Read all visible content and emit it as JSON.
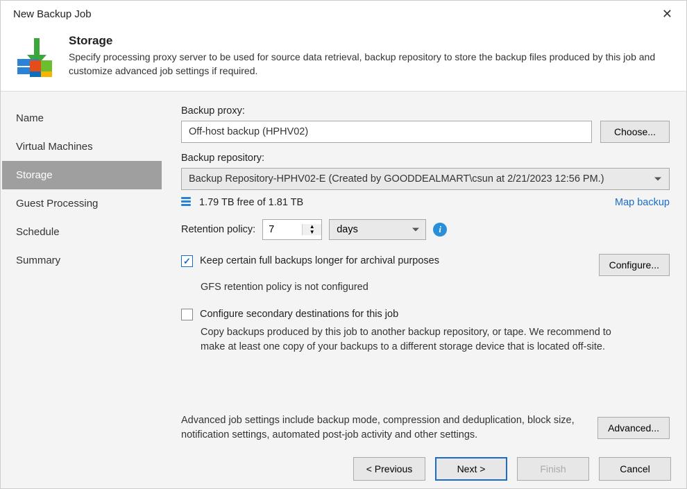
{
  "window": {
    "title": "New Backup Job"
  },
  "header": {
    "title": "Storage",
    "description": "Specify processing proxy server to be used for source data retrieval, backup repository to store the backup files produced by this job and customize advanced job settings if required."
  },
  "sidebar": {
    "items": [
      {
        "label": "Name"
      },
      {
        "label": "Virtual Machines"
      },
      {
        "label": "Storage",
        "selected": true
      },
      {
        "label": "Guest Processing"
      },
      {
        "label": "Schedule"
      },
      {
        "label": "Summary"
      }
    ]
  },
  "content": {
    "backupProxyLabel": "Backup proxy:",
    "backupProxyValue": "Off-host backup (HPHV02)",
    "chooseLabel": "Choose...",
    "backupRepoLabel": "Backup repository:",
    "backupRepoSelected": "Backup Repository-HPHV02-E (Created by GOODDEALMART\\csun at 2/21/2023 12:56 PM.)",
    "freeSpace": "1.79 TB free of 1.81 TB",
    "mapBackup": "Map backup",
    "retentionLabel": "Retention policy:",
    "retentionValue": "7",
    "retentionUnit": "days",
    "configureLabel": "Configure...",
    "keepFullLabel": "Keep certain full backups longer for archival purposes",
    "keepFullSub": "GFS retention policy is not configured",
    "secondaryLabel": "Configure secondary destinations for this job",
    "secondarySub": "Copy backups produced by this job to another backup repository, or tape. We recommend to make at least one copy of your backups to a different storage device that is located off-site.",
    "advancedText": "Advanced job settings include backup mode, compression and deduplication, block size, notification settings, automated post-job activity and other settings.",
    "advancedLabel": "Advanced..."
  },
  "footer": {
    "previous": "<  Previous",
    "next": "Next  >",
    "finish": "Finish",
    "cancel": "Cancel"
  }
}
